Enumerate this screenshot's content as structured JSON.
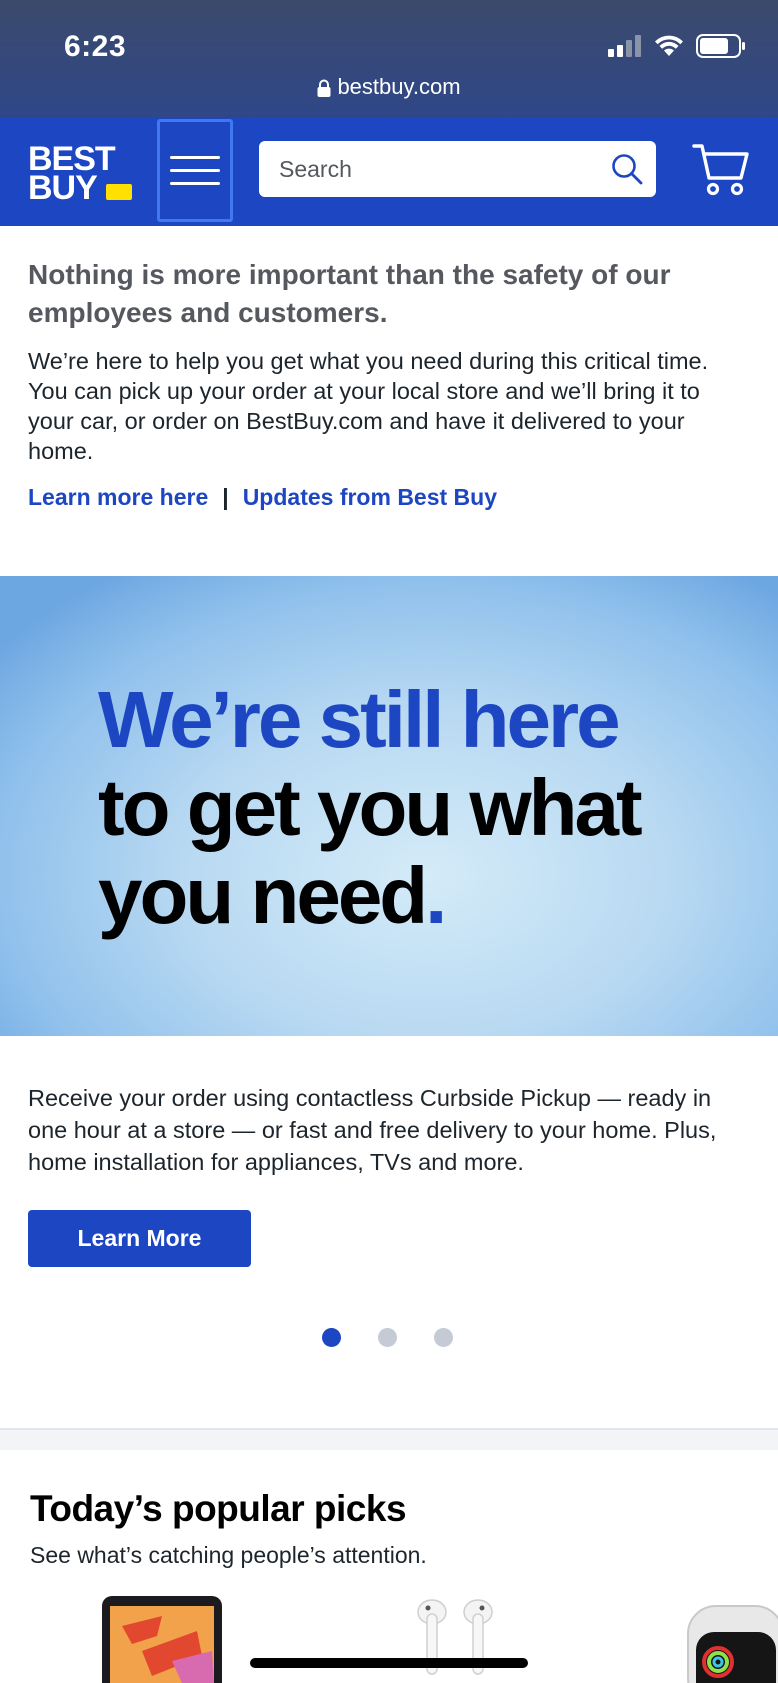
{
  "status_bar": {
    "time": "6:23"
  },
  "browser": {
    "url": "bestbuy.com"
  },
  "header": {
    "logo_line1": "BEST",
    "logo_line2": "BUY",
    "search_placeholder": "Search",
    "colors": {
      "brand_blue": "#1d46c3",
      "tag_yellow": "#ffe000"
    }
  },
  "notice": {
    "heading": "Nothing is more important than the safety of our employees and customers.",
    "body": "We’re here to help you get what you need during this critical time. You can pick up your order at your local store and we’ll bring it to your car, or order on BestBuy.com and have it delivered to your home.",
    "link1": "Learn more here",
    "separator": "|",
    "link2": "Updates from Best Buy"
  },
  "hero": {
    "line1": "We’re still here",
    "line2": "to get you what",
    "line3": "you need",
    "dot": "."
  },
  "promo": {
    "text": "Receive your order using contactless Curbside Pickup — ready in one hour at a store — or fast and free delivery to your home. Plus, home installation for appliances, TVs and more.",
    "button": "Learn More"
  },
  "carousel": {
    "active_index": 0,
    "count": 3
  },
  "popular": {
    "title": "Today’s popular picks",
    "subtitle": "See what’s catching people’s attention."
  },
  "products": [
    {
      "icon": "tablet-product-icon"
    },
    {
      "icon": "earbuds-product-icon"
    },
    {
      "icon": "smartwatch-product-icon"
    }
  ]
}
